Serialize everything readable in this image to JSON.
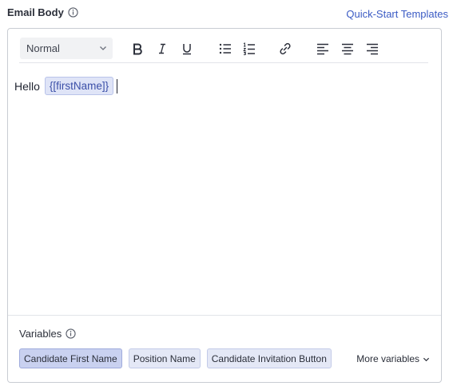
{
  "field": {
    "label": "Email Body",
    "templates_link": "Quick-Start Templates"
  },
  "toolbar": {
    "format_value": "Normal",
    "buttons": [
      "bold-icon",
      "italic-icon",
      "underline-icon",
      "bullet-list-icon",
      "numbered-list-icon",
      "link-icon",
      "align-left-icon",
      "align-center-icon",
      "align-right-icon"
    ]
  },
  "content": {
    "greeting": "Hello",
    "variable_token": "{[firstName]}"
  },
  "variables": {
    "label": "Variables",
    "chips": [
      {
        "label": "Candidate First Name",
        "active": true
      },
      {
        "label": "Position Name",
        "active": false
      },
      {
        "label": "Candidate Invitation Button",
        "active": false
      }
    ],
    "more_label": "More variables"
  },
  "colors": {
    "link": "#3b5bc4",
    "chip_active": "#c9d1f0",
    "chip": "#e4e8f6",
    "token": "#dfe4f7"
  }
}
